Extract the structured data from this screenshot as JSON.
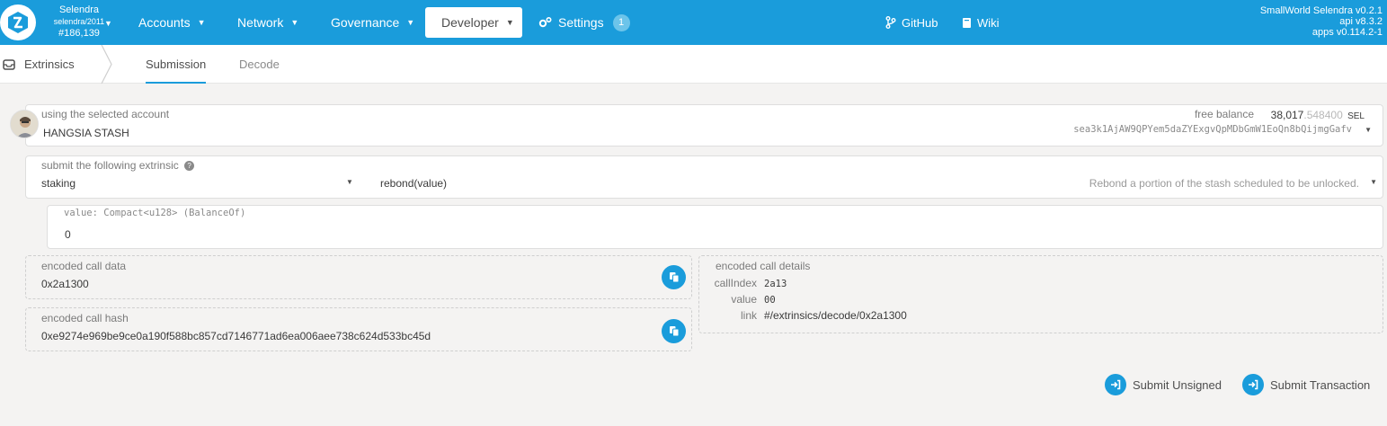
{
  "chain": {
    "name": "Selendra",
    "sub": "selendra/2011",
    "block": "#186,139"
  },
  "nav": {
    "accounts": "Accounts",
    "network": "Network",
    "governance": "Governance",
    "developer": "Developer",
    "settings": "Settings",
    "settings_badge": "1"
  },
  "links": {
    "github": "GitHub",
    "wiki": "Wiki"
  },
  "versions": {
    "node": "SmallWorld Selendra v0.2.1",
    "api": "api v8.3.2",
    "apps": "apps v0.114.2-1"
  },
  "subnav": {
    "title": "Extrinsics",
    "tabs": [
      "Submission",
      "Decode"
    ]
  },
  "account": {
    "label": "using the selected account",
    "name": "HANGSIA STASH",
    "balance_label": "free balance",
    "balance_int": "38,017",
    "balance_dec": ".548400",
    "balance_unit": "SEL",
    "address": "sea3k1AjAW9QPYem5daZYExgvQpMDbGmW1EoQn8bQijmgGafv"
  },
  "extrinsic": {
    "label": "submit the following extrinsic",
    "module": "staking",
    "method": "rebond(value)",
    "description": "Rebond a portion of the stash scheduled to be unlocked."
  },
  "param": {
    "label": "value: Compact<u128> (BalanceOf)",
    "value": "0"
  },
  "encoded_data": {
    "label": "encoded call data",
    "value": "0x2a1300"
  },
  "encoded_hash": {
    "label": "encoded call hash",
    "value": "0xe9274e969be9ce0a190f588bc857cd7146771ad6ea006aee738c624d533bc45d"
  },
  "details": {
    "label": "encoded call details",
    "rows": [
      {
        "key": "callIndex",
        "value": "2a13"
      },
      {
        "key": "value",
        "value": "00"
      },
      {
        "key": "link",
        "value": "#/extrinsics/decode/0x2a1300"
      }
    ]
  },
  "actions": {
    "unsigned": "Submit Unsigned",
    "transaction": "Submit Transaction"
  },
  "colors": {
    "topbar": "#1a9cdb",
    "accent": "#1a9cdb",
    "background": "#f4f3f2"
  }
}
